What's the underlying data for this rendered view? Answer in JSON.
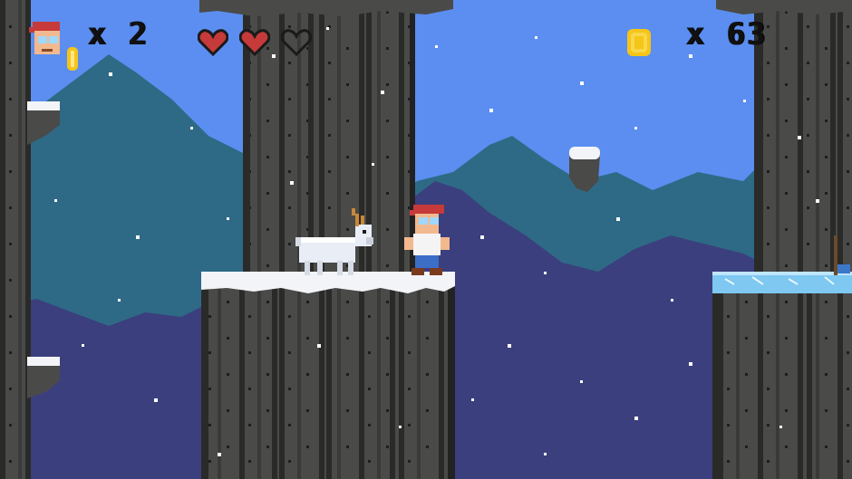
{
  "hud": {
    "lives_text": "x 2",
    "lives": 2,
    "hearts_total": 3,
    "hearts_full": 2,
    "coins_text": "x 63",
    "coins": 63
  },
  "colors": {
    "sky": "#5b8ef0",
    "mountain_far": "#2e6a86",
    "mountain_near": "#3b3f7d",
    "rock": "#4a4a48",
    "rock_dark": "#2d2d2c",
    "snow": "#f2f4f8",
    "ice": "#7ec8f2",
    "heart_full": "#c63a3a",
    "heart_empty": "#1a1a1a",
    "coin": "#f5c518"
  },
  "icons": [
    "player-head-icon",
    "coin-icon",
    "heart-icon"
  ]
}
